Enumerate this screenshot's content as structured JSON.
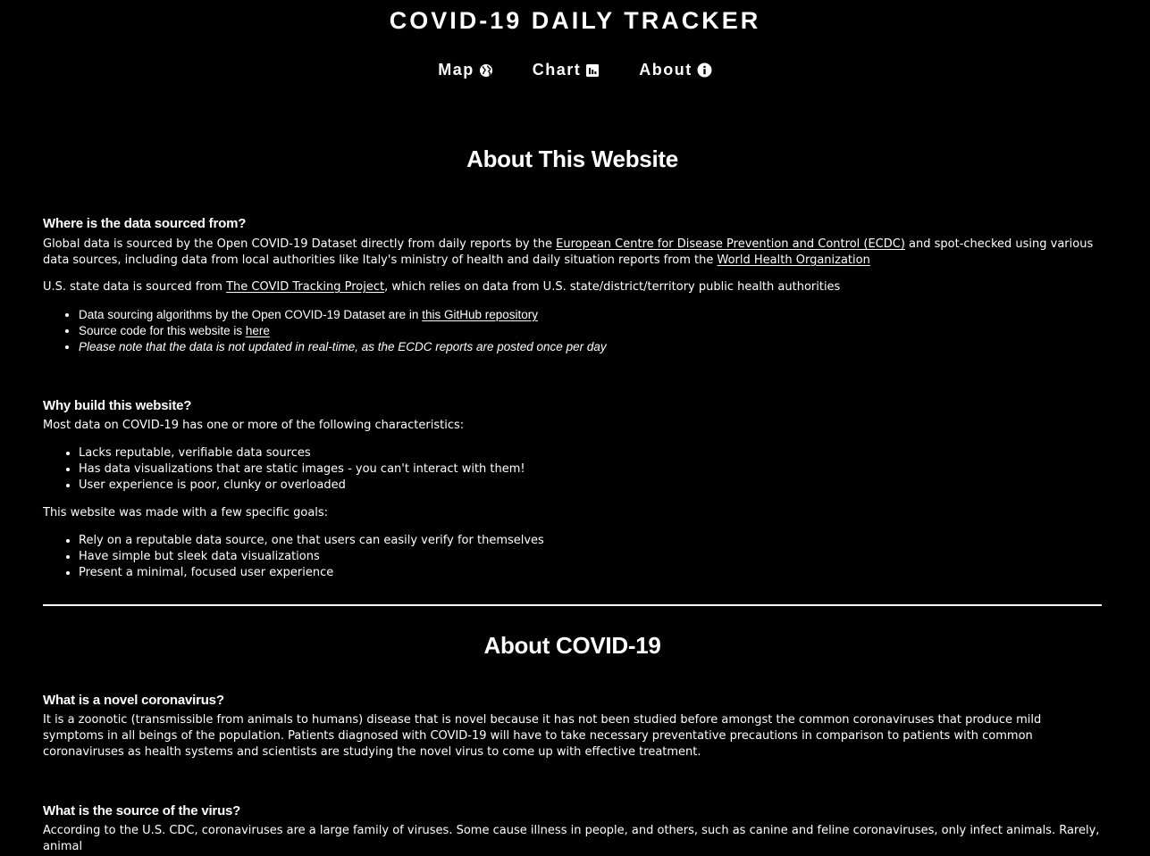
{
  "header": {
    "title": "COVID-19 DAILY TRACKER"
  },
  "nav": {
    "items": [
      {
        "label": "Map",
        "icon": "globe-icon"
      },
      {
        "label": "Chart",
        "icon": "bar-chart-icon"
      },
      {
        "label": "About",
        "icon": "info-icon"
      }
    ]
  },
  "about_site": {
    "title": "About This Website",
    "q1": {
      "heading": "Where is the data sourced from?",
      "p1_pre": "Global data is sourced by the Open COVID-19 Dataset directly from daily reports by the ",
      "p1_link1": "European Centre for Disease Prevention and Control (ECDC)",
      "p1_mid": " and spot-checked using various data sources, including data from local authorities like Italy's ministry of health and daily situation reports from the ",
      "p1_link2": "World Health Organization",
      "p2_pre": "U.S. state data is sourced from ",
      "p2_link": "The COVID Tracking Project",
      "p2_post": ", which relies on data from U.S. state/district/territory public health authorities",
      "bullet1_pre": "Data sourcing algorithms by the Open COVID-19 Dataset are in ",
      "bullet1_link": "this GitHub repository",
      "bullet2_pre": "Source code for this website is ",
      "bullet2_link": "here",
      "bullet3": "Please note that the data is not updated in real-time, as the ECDC reports are posted once per day"
    },
    "q2": {
      "heading": "Why build this website?",
      "intro": "Most data on COVID-19 has one or more of the following characteristics:",
      "problems": [
        "Lacks reputable, verifiable data sources",
        "Has data visualizations that are static images - you can't interact with them!",
        "User experience is poor, clunky or overloaded"
      ],
      "goals_intro": "This website was made with a few specific goals:",
      "goals": [
        "Rely on a reputable data source, one that users can easily verify for themselves",
        "Have simple but sleek data visualizations",
        "Present a minimal, focused user experience"
      ]
    }
  },
  "about_covid": {
    "title": "About COVID-19",
    "q1": {
      "heading": "What is a novel coronavirus?",
      "text": "It is a zoonotic (transmissible from animals to humans) disease that is novel because it has not been studied before amongst the common coronaviruses that produce mild symptoms in all beings of the population. Patients diagnosed with COVID-19 will have to take necessary preventative precautions in comparison to patients with common coronaviruses as health systems and scientists are studying the novel virus to come up with effective treatment."
    },
    "q2": {
      "heading": "What is the source of the virus?",
      "text": "According to the U.S. CDC, coronaviruses are a large family of viruses. Some cause illness in people, and others, such as canine and feline coronaviruses, only infect animals. Rarely, animal"
    }
  }
}
